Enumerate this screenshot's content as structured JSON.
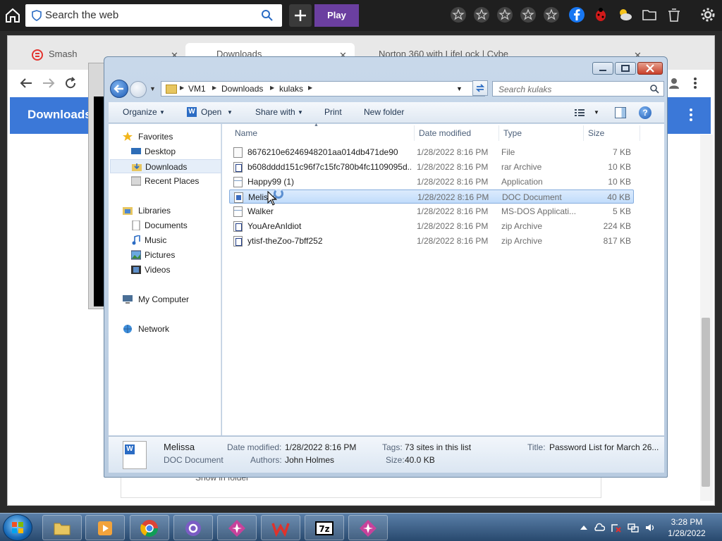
{
  "topbar": {
    "search_placeholder": "Search the web",
    "play_label": "Play"
  },
  "browser": {
    "tabs": [
      {
        "label": "Smash"
      },
      {
        "label": "Downloads"
      },
      {
        "label": "Norton 360 with LifeLock | Cybe"
      }
    ],
    "banner_title": "Downloads",
    "card_text": "Show in folder"
  },
  "explorer": {
    "breadcrumb": [
      "VM1",
      "Downloads",
      "kulaks"
    ],
    "search_placeholder": "Search kulaks",
    "toolbar": {
      "organize": "Organize",
      "open": "Open",
      "share_with": "Share with",
      "print": "Print",
      "new_folder": "New folder"
    },
    "nav": {
      "favorites": "Favorites",
      "desktop": "Desktop",
      "downloads": "Downloads",
      "recent_places": "Recent Places",
      "libraries": "Libraries",
      "documents": "Documents",
      "music": "Music",
      "pictures": "Pictures",
      "videos": "Videos",
      "my_computer": "My Computer",
      "network": "Network"
    },
    "columns": {
      "name": "Name",
      "date_modified": "Date modified",
      "type": "Type",
      "size": "Size"
    },
    "files": [
      {
        "name": "8676210e6246948201aa014db471de90",
        "date": "1/28/2022 8:16 PM",
        "type": "File",
        "size": "7 KB"
      },
      {
        "name": "b608dddd151c96f7c15fc780b4fc1109095d...",
        "date": "1/28/2022 8:16 PM",
        "type": "rar Archive",
        "size": "10 KB"
      },
      {
        "name": "Happy99 (1)",
        "date": "1/28/2022 8:16 PM",
        "type": "Application",
        "size": "10 KB"
      },
      {
        "name": "Melissa",
        "date": "1/28/2022 8:16 PM",
        "type": "DOC Document",
        "size": "40 KB"
      },
      {
        "name": "Walker",
        "date": "1/28/2022 8:16 PM",
        "type": "MS-DOS Applicati...",
        "size": "5 KB"
      },
      {
        "name": "YouAreAnIdiot",
        "date": "1/28/2022 8:16 PM",
        "type": "zip Archive",
        "size": "224 KB"
      },
      {
        "name": "ytisf-theZoo-7bff252",
        "date": "1/28/2022 8:16 PM",
        "type": "zip Archive",
        "size": "817 KB"
      }
    ],
    "details": {
      "name": "Melissa",
      "kind": "DOC Document",
      "date_modified_label": "Date modified:",
      "date_modified": "1/28/2022 8:16 PM",
      "authors_label": "Authors:",
      "authors": "John Holmes",
      "tags_label": "Tags:",
      "tags": "73 sites in this list",
      "size_label": "Size:",
      "size": "40.0 KB",
      "title_label": "Title:",
      "title": "Password List for March 26..."
    }
  },
  "taskbar": {
    "time": "3:28 PM",
    "date": "1/28/2022"
  },
  "colors": {
    "banner": "#3b78d8",
    "play": "#6b3fa0",
    "selection": "#c1dcfb"
  }
}
